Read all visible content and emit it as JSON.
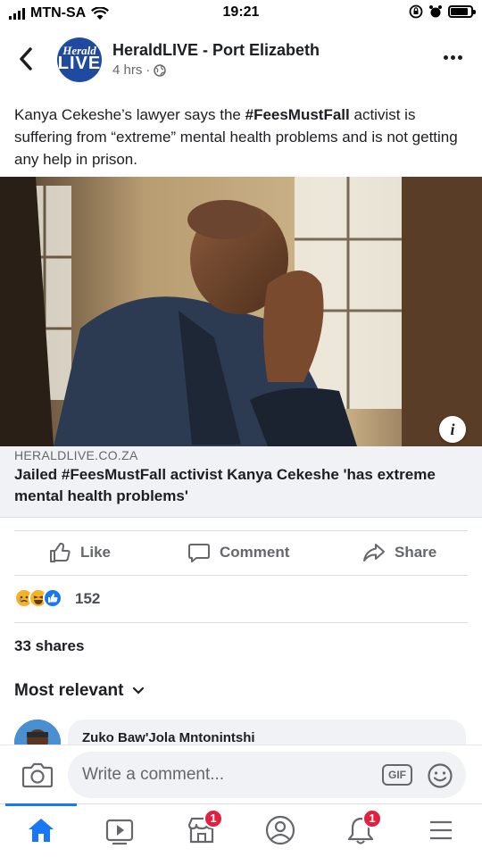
{
  "status_bar": {
    "carrier": "MTN-SA",
    "time": "19:21",
    "battery_level": 0.85
  },
  "post": {
    "page_name": "HeraldLIVE - Port Elizabeth",
    "avatar_text_top": "Herald",
    "avatar_text_bottom": "LIVE",
    "time_ago": "4 hrs",
    "separator": "·",
    "text_before": "Kanya Cekeshe’s lawyer says the ",
    "text_hashtag": "#FeesMustFall",
    "text_after": " activist is suffering from “extreme” mental health problems and is not getting any help in prison."
  },
  "link_preview": {
    "domain": "HERALDLIVE.CO.ZA",
    "title": "Jailed #FeesMustFall activist Kanya Cekeshe 'has extreme mental health problems'",
    "info_icon_label": "i"
  },
  "actions": {
    "like_label": "Like",
    "comment_label": "Comment",
    "share_label": "Share"
  },
  "engagement": {
    "reaction_count": "152",
    "reaction_icons": [
      "sad-reaction",
      "haha-reaction",
      "like-reaction"
    ],
    "shares_text": "33 shares"
  },
  "comments": {
    "sort_label": "Most relevant",
    "first_author": "Zuko Baw'Jola Mntonintshi"
  },
  "composer": {
    "placeholder": "Write a comment...",
    "gif_label": "GIF"
  },
  "tabbar": {
    "marketplace_badge": "1",
    "notifications_badge": "1"
  },
  "colors": {
    "accent": "#1877f2",
    "badge": "#e41e3f",
    "brand_avatar": "#1f4aa0"
  }
}
